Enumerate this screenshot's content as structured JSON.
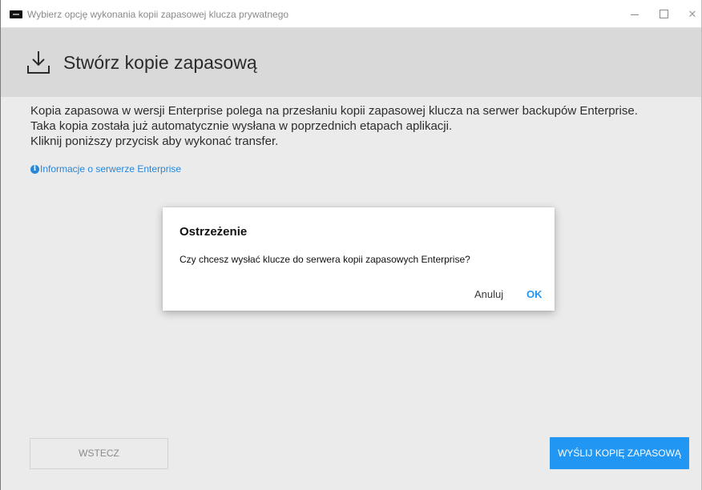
{
  "window": {
    "title": "Wybierz opcję wykonania kopii zapasowej klucza prywatnego",
    "controls": {
      "minimize_icon": "minimize-icon",
      "maximize_icon": "maximize-icon",
      "close_glyph": "✕"
    }
  },
  "header": {
    "icon": "download-icon",
    "title": "Stwórz kopie zapasową"
  },
  "body": {
    "lines": [
      "Kopia zapasowa w wersji Enterprise polega na przesłaniu kopii zapasowej klucza na serwer backupów Enterprise.",
      "Taka kopia została już automatycznie wysłana w poprzednich etapach aplikacji.",
      "Kliknij poniższy przycisk aby wykonać transfer."
    ],
    "info_link": {
      "icon": "info-icon",
      "icon_glyph": "i",
      "label": "Informacje o serwerze Enterprise"
    }
  },
  "dialog": {
    "title": "Ostrzeżenie",
    "message": "Czy chcesz wysłać klucze do serwera kopii zapasowych Enterprise?",
    "cancel_label": "Anuluj",
    "ok_label": "OK"
  },
  "footer": {
    "back_label": "WSTECZ",
    "send_label": "WYŚLIJ KOPIĘ ZAPASOWĄ"
  },
  "colors": {
    "accent": "#2196f3",
    "link": "#2a86d8",
    "background": "#ebebeb",
    "header_band": "#d9d9d9"
  }
}
